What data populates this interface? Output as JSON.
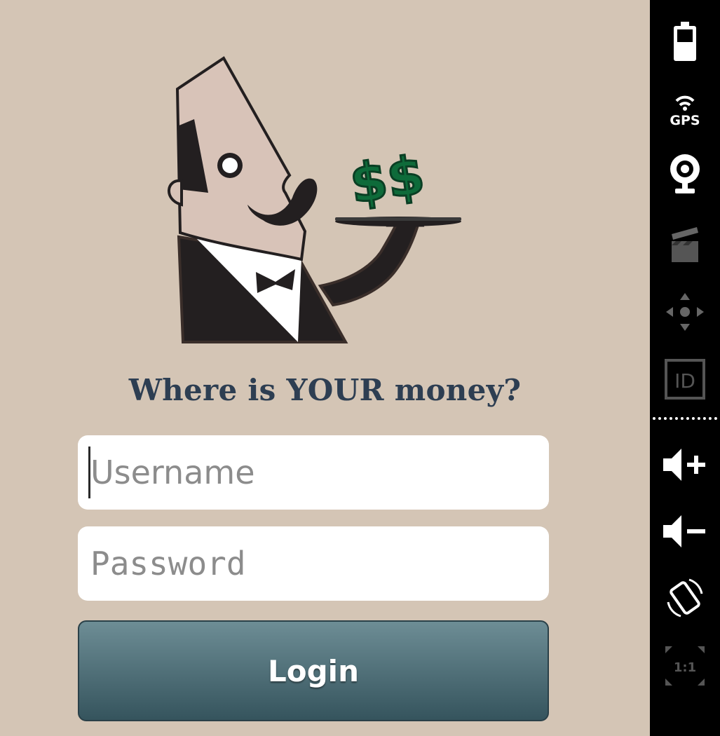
{
  "app": {
    "tagline": "Where is YOUR money?",
    "username": {
      "value": "",
      "placeholder": "Username"
    },
    "password": {
      "value": "",
      "placeholder": "Password"
    },
    "login_label": "Login",
    "colors": {
      "background": "#d4c5b5",
      "tagline": "#2d3e52",
      "button_top": "#6d8d95",
      "button_bottom": "#35545d",
      "dollar": "#0e6b3a"
    },
    "mascot_dollars": "$$"
  },
  "sidebar": {
    "buttons": [
      {
        "name": "battery",
        "icon": "battery-icon",
        "enabled": true
      },
      {
        "name": "gps",
        "icon": "gps-icon",
        "label": "GPS",
        "enabled": true
      },
      {
        "name": "camera",
        "icon": "webcam-icon",
        "enabled": true
      },
      {
        "name": "capture",
        "icon": "clapperboard-icon",
        "enabled": false
      },
      {
        "name": "dpad",
        "icon": "dpad-icon",
        "enabled": false
      },
      {
        "name": "id",
        "icon": "id-icon",
        "label": "ID",
        "enabled": false
      },
      {
        "name": "volume-up",
        "icon": "volume-up-icon",
        "enabled": true
      },
      {
        "name": "volume-down",
        "icon": "volume-down-icon",
        "enabled": true
      },
      {
        "name": "rotate",
        "icon": "rotate-icon",
        "enabled": true
      },
      {
        "name": "scale",
        "icon": "scale-icon",
        "label": "1:1",
        "enabled": false
      }
    ]
  }
}
